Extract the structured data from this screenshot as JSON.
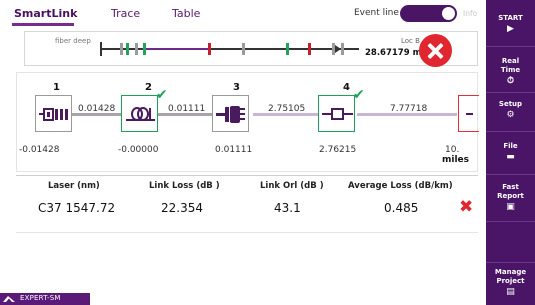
{
  "tabs": [
    {
      "label": "SmartLink",
      "active": true
    },
    {
      "label": "Trace",
      "active": false
    },
    {
      "label": "Table",
      "active": false
    }
  ],
  "event_line": {
    "label": "Event line",
    "state": "on",
    "info_label": "Info"
  },
  "fiber_strip": {
    "label": "fiber deep",
    "loc_label": "Loc B",
    "distance": "28.67179 miles",
    "result": "fail",
    "event_colors": [
      "#9b9b9b",
      "#22a35a",
      "#9b9b9b",
      "#22a35a",
      "#c8202a",
      "#9b9b9b",
      "#22a35a",
      "#c8202a",
      "#9b9b9b",
      "#9b9b9b"
    ]
  },
  "link_view": {
    "elements": [
      {
        "number": "1",
        "icon": "launch-connector-icon",
        "value": "-0.01428",
        "status": "neutral"
      },
      {
        "number": "2",
        "icon": "splice-coil-icon",
        "value": "-0.00000",
        "status": "pass"
      },
      {
        "number": "3",
        "icon": "connector-plug-icon",
        "value": "0.01111",
        "status": "neutral"
      },
      {
        "number": "4",
        "icon": "splice-box-icon",
        "value": "2.76215",
        "status": "pass"
      }
    ],
    "connections": [
      "0.01428",
      "0.01111",
      "2.75105",
      "7.77718"
    ],
    "trailing_value": "10.",
    "unit": "miles"
  },
  "results": {
    "headers": [
      "Laser (nm)",
      "Link Loss (dB )",
      "Link Orl (dB )",
      "Average Loss (dB/km)"
    ],
    "row": {
      "laser": "C37 1547.72",
      "link_loss": "22.354",
      "link_orl": "43.1",
      "avg_loss": "0.485",
      "status": "fail"
    }
  },
  "status_bar": {
    "text": "EXPERT-SM",
    "icon": "fiber-module-icon"
  },
  "sidebar": [
    {
      "label": "START",
      "icon": "play-icon",
      "glyph": "▶"
    },
    {
      "label": "Real Time",
      "icon": "stopwatch-icon",
      "glyph": "⏱"
    },
    {
      "label": "Setup",
      "icon": "gear-icon",
      "glyph": "⚙"
    },
    {
      "label": "File",
      "icon": "folder-icon",
      "glyph": "▬"
    },
    {
      "label": "Fast Report",
      "icon": "report-icon",
      "glyph": "▣"
    },
    {
      "label": "Manage Project",
      "icon": "project-icon",
      "glyph": "▤"
    }
  ],
  "colors": {
    "accent": "#4a1566",
    "fail": "#e0262e",
    "pass": "#22a35a"
  }
}
